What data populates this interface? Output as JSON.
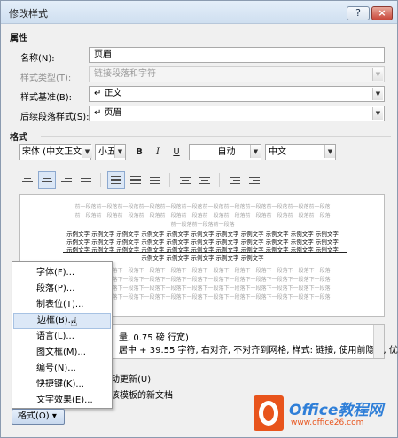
{
  "window": {
    "title": "修改样式",
    "help_label": "?",
    "close_label": "×"
  },
  "properties": {
    "section_label": "属性",
    "name_label": "名称(N):",
    "name_value": "页眉",
    "style_type_label": "样式类型(T):",
    "style_type_value": "链接段落和字符",
    "based_on_label": "样式基准(B):",
    "based_on_value": "↵ 正文",
    "following_label": "后续段落样式(S):",
    "following_value": "↵ 页眉"
  },
  "format_section": {
    "section_label": "格式",
    "font_name": "宋体 (中文正文)",
    "font_size": "小五",
    "bold": "B",
    "italic": "I",
    "underline": "U",
    "color": "自动",
    "language": "中文"
  },
  "preview": {
    "prev_line_1": "前一段落前一段落前一段落前一段落前一段落前一段落前一段落前一段落前一段落前一段落前一段落前一段落",
    "prev_line_2": "前一段落前一段落前一段落前一段落前一段落前一段落前一段落前一段落前一段落前一段落前一段落前一段落",
    "prev_line_3": "前一段落前一段落前一段落",
    "sample_1": "示例文字 示例文字 示例文字 示例文字 示例文字 示例文字 示例文字 示例文字 示例文字 示例文字 示例文字",
    "sample_2": "示例文字 示例文字 示例文字 示例文字 示例文字 示例文字 示例文字 示例文字 示例文字 示例文字 示例文字",
    "sample_3": "示例文字 示例文字 示例文字 示例文字 示例文字 示例文字 示例文字 示例文字 示例文字 示例文字 示例文字",
    "sample_4": "示例文字 示例文字 示例文字 示例文字 示例文字",
    "next_line_1": "下一段落下一段落下一段落下一段落下一段落下一段落下一段落下一段落下一段落下一段落下一段落下一段落",
    "next_line_2": "下一段落下一段落下一段落下一段落下一段落下一段落下一段落下一段落下一段落下一段落下一段落下一段落",
    "next_line_3": "下一段落下一段落下一段落下一段落下一段落下一段落下一段落下一段落下一段落下一段落下一段落下一段落",
    "next_line_4": "下一段落下一段落下一段落下一段落下一段落下一段落下一段落下一段落下一段落下一段落下一段落下一段落"
  },
  "description": {
    "line_1": "量, 0.75 磅 行宽)",
    "line_2": "居中 + 39.55 字符, 右对齐, 不对齐到网格, 样式: 链接, 使用前隐藏, 优"
  },
  "checkboxes": {
    "auto_update_label": "动更新(U)",
    "template_label": "该模板的新文档"
  },
  "format_menu": {
    "button_label": "格式(O) ▾",
    "items": [
      "字体(F)...",
      "段落(P)...",
      "制表位(T)...",
      "边框(B)...",
      "语言(L)...",
      "图文框(M)...",
      "编号(N)...",
      "快捷键(K)...",
      "文字效果(E)..."
    ],
    "highlighted_index": 3
  },
  "watermark": {
    "brand": "Office教程网",
    "url": "www.office26.com"
  }
}
